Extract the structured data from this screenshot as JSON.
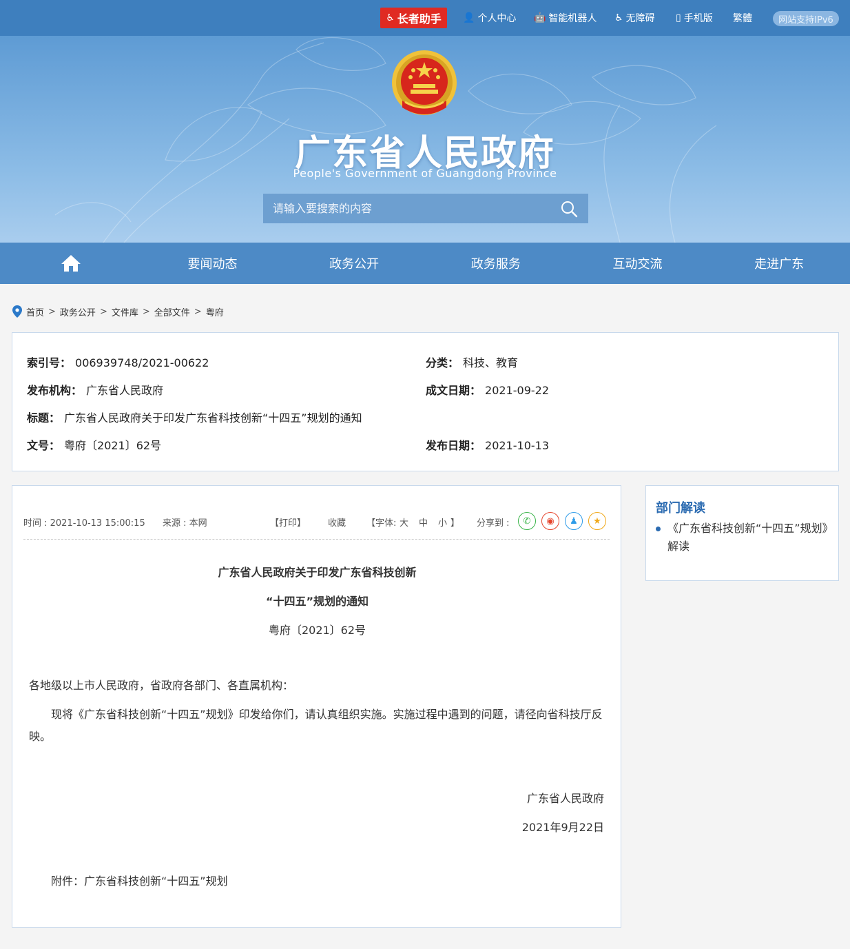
{
  "topbar": {
    "elder_label": "长者助手",
    "personal": "个人中心",
    "robot": "智能机器人",
    "accessible": "无障碍",
    "mobile": "手机版",
    "traditional": "繁體",
    "ipv6": "网站支持IPv6"
  },
  "banner": {
    "title": "广东省人民政府",
    "subtitle": "People's Government of Guangdong Province",
    "search_placeholder": "请输入要搜索的内容"
  },
  "nav": {
    "items": [
      "要闻动态",
      "政务公开",
      "政务服务",
      "互动交流",
      "走进广东"
    ]
  },
  "breadcrumb": [
    "首页",
    "政务公开",
    "文件库",
    "全部文件",
    "粤府"
  ],
  "meta": {
    "index_label": "索引号：",
    "index_value": "006939748/2021-00622",
    "category_label": "分类：",
    "category_value": "科技、教育",
    "publisher_label": "发布机构：",
    "publisher_value": "广东省人民政府",
    "written_label": "成文日期：",
    "written_value": "2021-09-22",
    "title_label": "标题：",
    "title_value": "广东省人民政府关于印发广东省科技创新“十四五”规划的通知",
    "docno_label": "文号：",
    "docno_value": "粤府〔2021〕62号",
    "pubdate_label": "发布日期：",
    "pubdate_value": "2021-10-13"
  },
  "article": {
    "time": "时间 : 2021-10-13 15:00:15",
    "source": "来源 : 本网",
    "print": "【打印】",
    "collect": "收藏",
    "font_label": "【字体:",
    "font_large": "大",
    "font_medium": "中",
    "font_small": "小",
    "font_end": "】",
    "share_label": "分享到 :",
    "title_line1": "广东省人民政府关于印发广东省科技创新",
    "title_line2": "“十四五”规划的通知",
    "docno": "粤府〔2021〕62号",
    "salutation": "各地级以上市人民政府，省政府各部门、各直属机构：",
    "body": "现将《广东省科技创新“十四五”规划》印发给你们，请认真组织实施。实施过程中遇到的问题，请径向省科技厅反映。",
    "sign_org": "广东省人民政府",
    "sign_date": "2021年9月22日",
    "attachment": "附件：广东省科技创新“十四五”规划"
  },
  "side": {
    "heading": "部门解读",
    "link": "《广东省科技创新“十四五”规划》解读"
  }
}
